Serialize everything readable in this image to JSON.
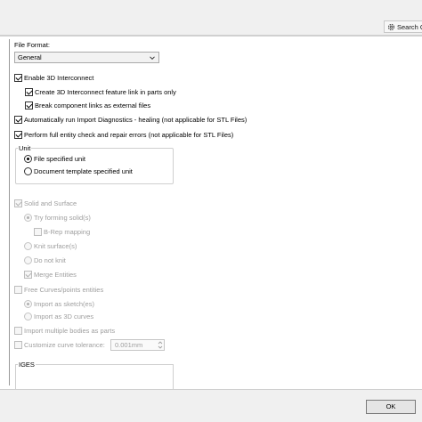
{
  "toolbar": {
    "search_label": "Search O",
    "search_icon": "gear-icon"
  },
  "file_format": {
    "label": "File Format:",
    "selected": "General"
  },
  "options": {
    "enable_3d": "Enable 3D Interconnect",
    "create_feature_link": "Create 3D Interconnect feature link in parts only",
    "break_links": "Break component links as external files",
    "auto_diagnostics": "Automatically run Import Diagnostics - healing (not applicable for STL Files)",
    "full_entity_check": "Perform full entity check and repair errors (not applicable for STL Files)"
  },
  "unit": {
    "legend": "Unit",
    "file_specified": "File specified unit",
    "document_template": "Document template specified unit"
  },
  "surface": {
    "solid_and_surface": "Solid and Surface",
    "try_forming": "Try forming solid(s)",
    "brep": "B-Rep mapping",
    "knit": "Knit surface(s)",
    "do_not_knit": "Do not knit",
    "merge_entities": "Merge Entities"
  },
  "curves": {
    "free_curves": "Free Curves/points entities",
    "import_sketch": "Import as sketch(es)",
    "import_3d": "Import as 3D curves"
  },
  "misc": {
    "multiple_bodies": "Import multiple bodies as parts",
    "customize_tolerance": "Customize curve tolerance:",
    "tolerance_value": "0.001mm"
  },
  "iges": {
    "legend": "IGES"
  },
  "footer": {
    "ok_label": "OK"
  }
}
